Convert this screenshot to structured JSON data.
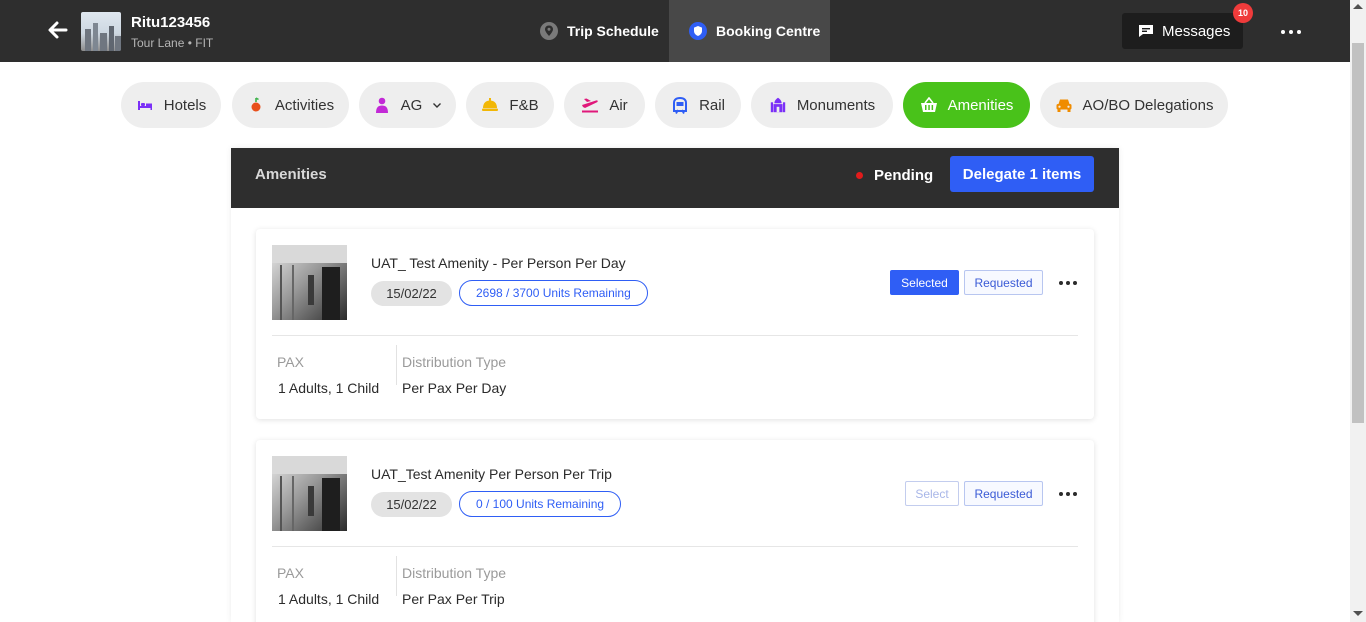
{
  "user": {
    "name": "Ritu123456",
    "subtitle": "Tour Lane • FIT"
  },
  "nav": {
    "trip_schedule": "Trip Schedule",
    "booking_centre": "Booking Centre"
  },
  "messages": {
    "label": "Messages",
    "badge": "10"
  },
  "categories": [
    {
      "label": "Hotels",
      "icon": "bed-icon",
      "color": "#7b2ff7"
    },
    {
      "label": "Activities",
      "icon": "firework-icon",
      "color": "#e8501c"
    },
    {
      "label": "AG",
      "icon": "guide-person-icon",
      "color": "#c229d6",
      "dropdown": true
    },
    {
      "label": "F&B",
      "icon": "service-bell-icon",
      "color": "#f2b705"
    },
    {
      "label": "Air",
      "icon": "airplane-icon",
      "color": "#e0187a"
    },
    {
      "label": "Rail",
      "icon": "train-icon",
      "color": "#2f5ef5"
    },
    {
      "label": "Monuments",
      "icon": "monument-icon",
      "color": "#7b2ff7"
    },
    {
      "label": "Amenities",
      "icon": "basket-icon",
      "color": "#ffffff",
      "active": true
    },
    {
      "label": "AO/BO Delegations",
      "icon": "car-icon",
      "color": "#f08c00"
    }
  ],
  "panel": {
    "title": "Amenities",
    "status": "Pending",
    "status_color": "#e11b1b",
    "delegate_label": "Delegate 1 items"
  },
  "cards": [
    {
      "title": "UAT_ Test Amenity - Per Person Per Day",
      "date": "15/02/22",
      "units": "2698 / 3700 Units Remaining",
      "select_label": "Selected",
      "select_state": "selected",
      "requested_label": "Requested",
      "pax_label": "PAX",
      "pax_value": "1 Adults, 1 Child",
      "dist_label": "Distribution Type",
      "dist_value": "Per Pax Per Day"
    },
    {
      "title": "UAT_Test Amenity Per Person Per Trip",
      "date": "15/02/22",
      "units": "0 / 100 Units Remaining",
      "select_label": "Select",
      "select_state": "disabled",
      "requested_label": "Requested",
      "pax_label": "PAX",
      "pax_value": "1 Adults, 1 Child",
      "dist_label": "Distribution Type",
      "dist_value": "Per Pax Per Trip"
    }
  ],
  "colors": {
    "topbar": "#2e2e2e",
    "accent_blue": "#2f5ef5",
    "active_green": "#49c21a"
  }
}
